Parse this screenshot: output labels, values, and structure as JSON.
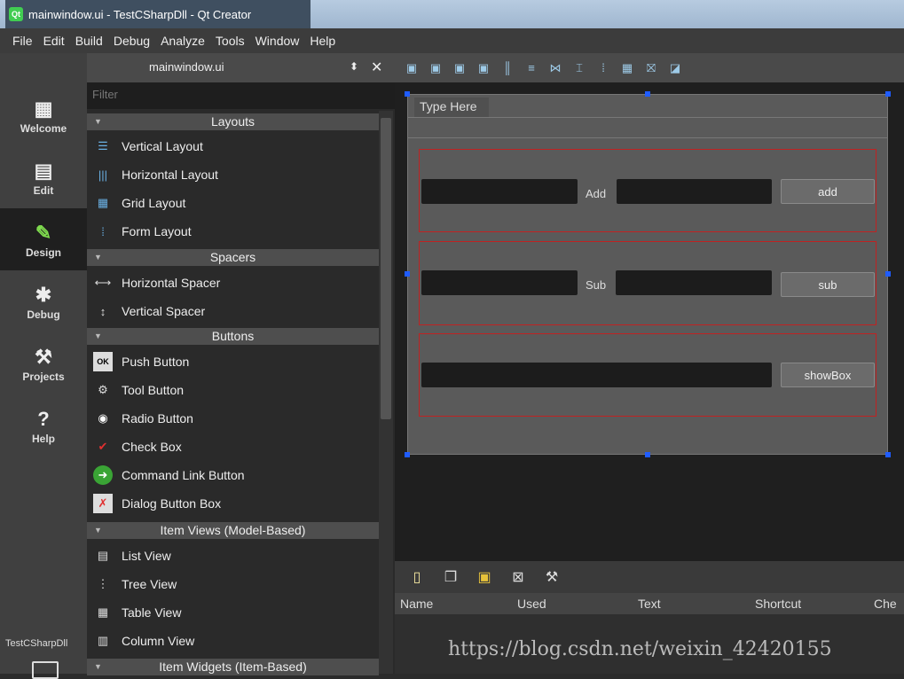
{
  "window": {
    "title": "mainwindow.ui - TestCSharpDll - Qt Creator",
    "logo_text": "Qt"
  },
  "menu": [
    "File",
    "Edit",
    "Build",
    "Debug",
    "Analyze",
    "Tools",
    "Window",
    "Help"
  ],
  "modes": [
    {
      "label": "Welcome",
      "icon": "grid-icon"
    },
    {
      "label": "Edit",
      "icon": "document-icon"
    },
    {
      "label": "Design",
      "icon": "pencil-icon"
    },
    {
      "label": "Debug",
      "icon": "bug-icon"
    },
    {
      "label": "Projects",
      "icon": "wrench-icon"
    },
    {
      "label": "Help",
      "icon": "help-icon"
    }
  ],
  "project_label": "TestCSharpDll",
  "file_selector": {
    "filename": "mainwindow.ui",
    "selector_glyph": "⬍",
    "close_glyph": "✕"
  },
  "widget_box": {
    "filter_placeholder": "Filter",
    "categories": [
      {
        "name": "Layouts",
        "items": [
          "Vertical Layout",
          "Horizontal Layout",
          "Grid Layout",
          "Form Layout"
        ]
      },
      {
        "name": "Spacers",
        "items": [
          "Horizontal Spacer",
          "Vertical Spacer"
        ]
      },
      {
        "name": "Buttons",
        "items": [
          "Push Button",
          "Tool Button",
          "Radio Button",
          "Check Box",
          "Command Link Button",
          "Dialog Button Box"
        ]
      },
      {
        "name": "Item Views (Model-Based)",
        "items": [
          "List View",
          "Tree View",
          "Table View",
          "Column View"
        ]
      },
      {
        "name": "Item Widgets (Item-Based)",
        "items": []
      }
    ]
  },
  "form": {
    "menu_placeholder": "Type Here",
    "row1": {
      "label": "Add",
      "button": "add"
    },
    "row2": {
      "label": "Sub",
      "button": "sub"
    },
    "row3": {
      "button": "showBox"
    }
  },
  "action_editor": {
    "columns": [
      "Name",
      "Used",
      "Text",
      "Shortcut",
      "Che"
    ]
  },
  "watermark": "https://blog.csdn.net/weixin_42420155"
}
